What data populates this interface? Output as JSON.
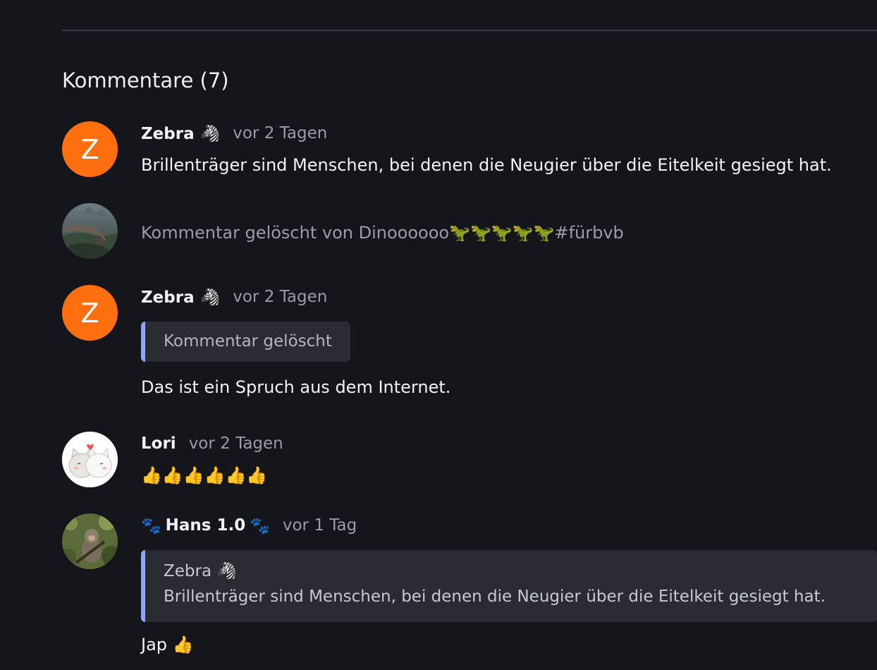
{
  "section": {
    "title": "Kommentare (7)"
  },
  "comments": [
    {
      "avatar_letter": "Z",
      "author": "Zebra 🦓",
      "time": "vor 2 Tagen",
      "text": "Brillenträger sind Menschen, bei denen die Neugier über die Eitelkeit gesiegt hat."
    },
    {
      "avatar": "dinosaur-photo-avatar",
      "deleted_text": "Kommentar gelöscht von Dinoooooo🦖🦖🦖🦖🦖#fürbvb"
    },
    {
      "avatar_letter": "Z",
      "author": "Zebra 🦓",
      "time": "vor 2 Tagen",
      "quote_text": "Kommentar gelöscht",
      "text": "Das ist ein Spruch aus dem Internet."
    },
    {
      "avatar": "cats-avatar",
      "author": "Lori",
      "time": "vor 2 Tagen",
      "text": "👍👍👍👍👍👍"
    },
    {
      "avatar": "monkey-photo-avatar",
      "paw_left": "🐾",
      "author": "Hans 1.0",
      "paw_right": "🐾",
      "time": "vor 1 Tag",
      "quote_author": "Zebra 🦓",
      "quote_text": "Brillenträger sind Menschen, bei denen die Neugier über die Eitelkeit gesiegt hat.",
      "text": "Jap 👍"
    }
  ],
  "colors": {
    "background": "#15161b",
    "avatar_orange": "#ff6f0f",
    "quote_accent": "#8ea6ff",
    "quote_background": "#2a2b33",
    "muted_text": "#9a9ca6"
  }
}
